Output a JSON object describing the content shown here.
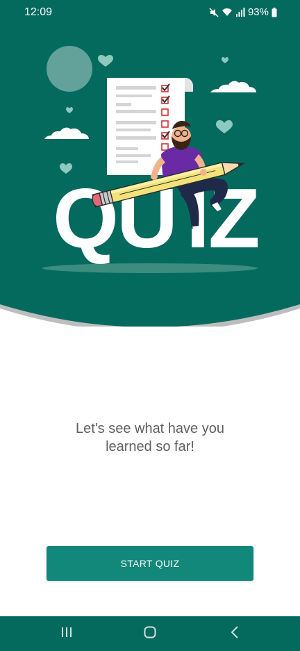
{
  "status_bar": {
    "time": "12:09",
    "battery": "93%"
  },
  "hero": {
    "title_letters": [
      "Q",
      "U",
      "I",
      "Z"
    ],
    "background_color": "#046a5e",
    "illustration_icons": [
      "checklist-paper-icon",
      "pencil-icon",
      "person-icon",
      "heart-icon",
      "cloud-icon"
    ]
  },
  "intro": {
    "line1": "Let's see what have you",
    "line2": "learned so far!"
  },
  "start_button": {
    "label": "START QUIZ",
    "color": "#11887a"
  },
  "nav_bar": {
    "icons": [
      "recent-apps-icon",
      "home-icon",
      "back-icon"
    ],
    "color": "#046a5e"
  }
}
